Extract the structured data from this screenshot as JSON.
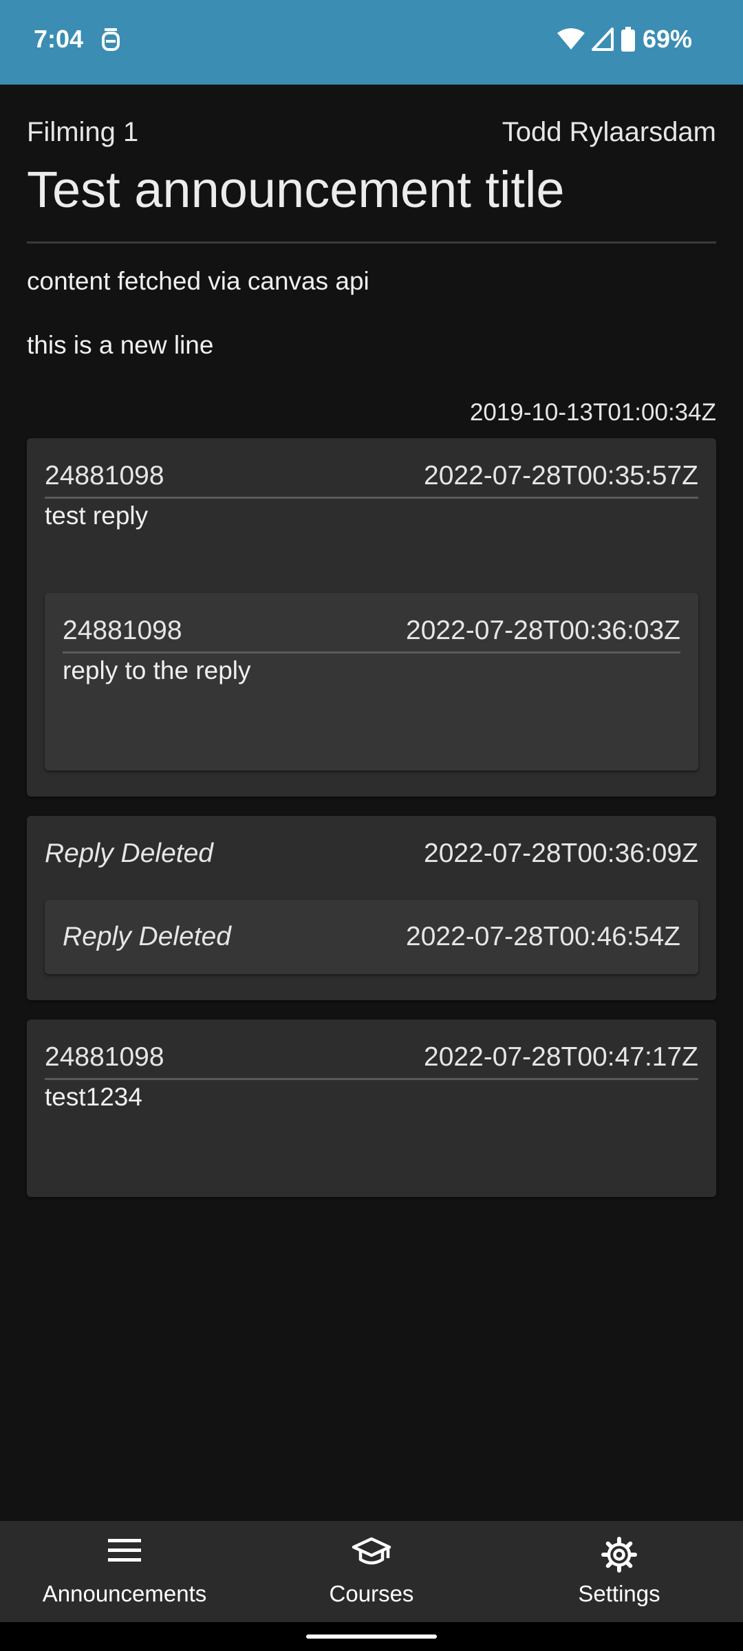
{
  "status_bar": {
    "time": "7:04",
    "battery": "69%",
    "icons": [
      "alarm-icon",
      "wifi-icon",
      "signal-icon",
      "battery-icon"
    ]
  },
  "announcement": {
    "course": "Filming 1",
    "author": "Todd Rylaarsdam",
    "title": "Test announcement title",
    "body": [
      "content fetched via canvas api",
      "this is a new line"
    ],
    "posted_at": "2019-10-13T01:00:34Z"
  },
  "replies": [
    {
      "author": "24881098",
      "date": "2022-07-28T00:35:57Z",
      "message": "test reply",
      "children": [
        {
          "author": "24881098",
          "date": "2022-07-28T00:36:03Z",
          "message": "reply to the reply"
        }
      ]
    },
    {
      "author": "Reply Deleted",
      "date": "2022-07-28T00:36:09Z",
      "children": [
        {
          "author": "Reply Deleted",
          "date": "2022-07-28T00:46:54Z"
        }
      ]
    },
    {
      "author": "24881098",
      "date": "2022-07-28T00:47:17Z",
      "message": "test1234"
    }
  ],
  "bottom_nav": {
    "items": [
      {
        "label": "Announcements",
        "icon": "menu-icon"
      },
      {
        "label": "Courses",
        "icon": "graduation-cap-icon"
      },
      {
        "label": "Settings",
        "icon": "gear-icon"
      }
    ]
  },
  "colors": {
    "status_bar": "#3b8db3",
    "background": "#121212",
    "card": "#2d2d2d",
    "nested_card": "#363636",
    "nav_bar": "#2b2b2b"
  }
}
